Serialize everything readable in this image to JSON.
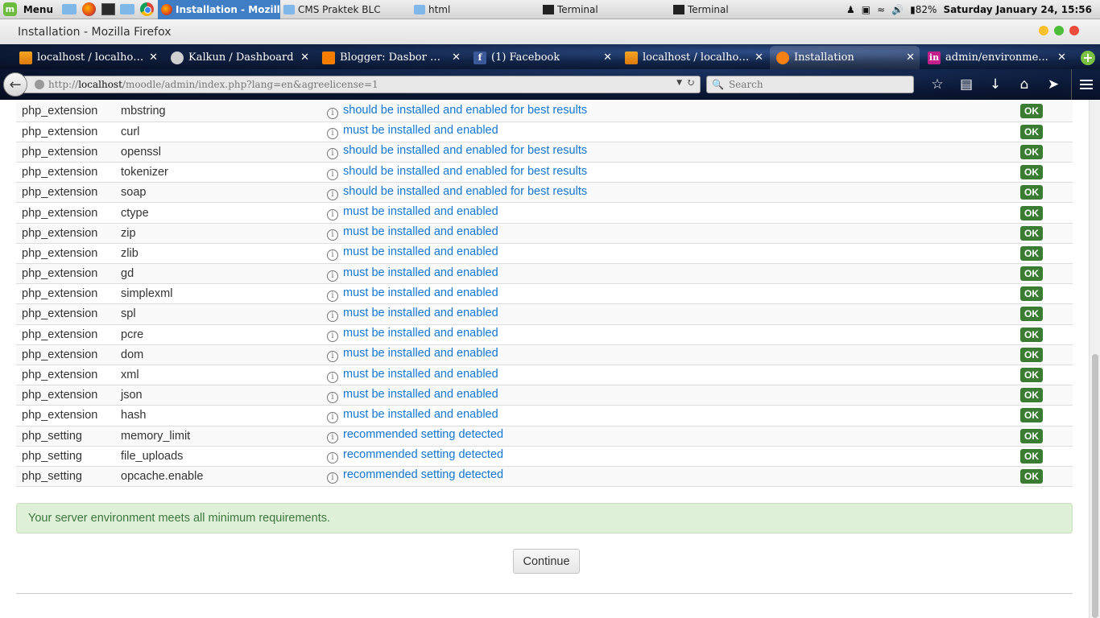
{
  "taskbar": {
    "menu_label": "Menu",
    "windows": [
      {
        "label": "Installation - Mozilla...",
        "icon": "firefox-icon",
        "active": true
      },
      {
        "label": "CMS Praktek BLC",
        "icon": "folder-icon",
        "active": false
      },
      {
        "label": "html",
        "icon": "folder-icon",
        "active": false
      },
      {
        "label": "Terminal",
        "icon": "terminal-icon",
        "active": false
      },
      {
        "label": "Terminal",
        "icon": "terminal-icon",
        "active": false
      }
    ],
    "battery": "82%",
    "clock": "Saturday January 24, 15:56"
  },
  "window": {
    "title": "Installation - Mozilla Firefox"
  },
  "tabs": [
    {
      "label": "localhost / localhos...",
      "favicon": "phpmyadmin-icon"
    },
    {
      "label": "Kalkun / Dashboard",
      "favicon": "kalkun-icon"
    },
    {
      "label": "Blogger: Dasbor Bl...",
      "favicon": "blogger-icon"
    },
    {
      "label": "(1) Facebook",
      "favicon": "facebook-icon"
    },
    {
      "label": "localhost / localhos...",
      "favicon": "phpmyadmin-icon"
    },
    {
      "label": "Installation",
      "favicon": "moodle-icon",
      "active": true
    },
    {
      "label": "admin/environme...",
      "favicon": "invision-icon"
    }
  ],
  "nav": {
    "url_prefix": "http://",
    "url_host": "localhost",
    "url_path": "/moodle/admin/index.php?lang=en&agreelicense=1",
    "search_placeholder": "Search"
  },
  "checks": [
    {
      "type": "php_extension",
      "name": "mbstring",
      "message": "should be installed and enabled for best results",
      "status": "OK"
    },
    {
      "type": "php_extension",
      "name": "curl",
      "message": "must be installed and enabled",
      "status": "OK"
    },
    {
      "type": "php_extension",
      "name": "openssl",
      "message": "should be installed and enabled for best results",
      "status": "OK"
    },
    {
      "type": "php_extension",
      "name": "tokenizer",
      "message": "should be installed and enabled for best results",
      "status": "OK"
    },
    {
      "type": "php_extension",
      "name": "soap",
      "message": "should be installed and enabled for best results",
      "status": "OK"
    },
    {
      "type": "php_extension",
      "name": "ctype",
      "message": "must be installed and enabled",
      "status": "OK"
    },
    {
      "type": "php_extension",
      "name": "zip",
      "message": "must be installed and enabled",
      "status": "OK"
    },
    {
      "type": "php_extension",
      "name": "zlib",
      "message": "must be installed and enabled",
      "status": "OK"
    },
    {
      "type": "php_extension",
      "name": "gd",
      "message": "must be installed and enabled",
      "status": "OK"
    },
    {
      "type": "php_extension",
      "name": "simplexml",
      "message": "must be installed and enabled",
      "status": "OK"
    },
    {
      "type": "php_extension",
      "name": "spl",
      "message": "must be installed and enabled",
      "status": "OK"
    },
    {
      "type": "php_extension",
      "name": "pcre",
      "message": "must be installed and enabled",
      "status": "OK"
    },
    {
      "type": "php_extension",
      "name": "dom",
      "message": "must be installed and enabled",
      "status": "OK"
    },
    {
      "type": "php_extension",
      "name": "xml",
      "message": "must be installed and enabled",
      "status": "OK"
    },
    {
      "type": "php_extension",
      "name": "json",
      "message": "must be installed and enabled",
      "status": "OK"
    },
    {
      "type": "php_extension",
      "name": "hash",
      "message": "must be installed and enabled",
      "status": "OK"
    },
    {
      "type": "php_setting",
      "name": "memory_limit",
      "message": "recommended setting detected",
      "status": "OK"
    },
    {
      "type": "php_setting",
      "name": "file_uploads",
      "message": "recommended setting detected",
      "status": "OK"
    },
    {
      "type": "php_setting",
      "name": "opcache.enable",
      "message": "recommended setting detected",
      "status": "OK"
    }
  ],
  "alert": "Your server environment meets all minimum requirements.",
  "continue_label": "Continue",
  "colors": {
    "ok_badge": "#3a7c32",
    "link_blue": "#1177d1",
    "alert_bg": "#dff0d8",
    "alert_text": "#3c763d"
  }
}
